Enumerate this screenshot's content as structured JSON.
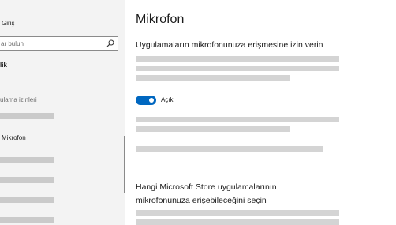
{
  "sidebar": {
    "home_label": "Giriş",
    "search_placeholder": "ar bulun",
    "category_label": "lik",
    "permissions_header": "ulama izinleri",
    "active_item_label": "Mikrofon"
  },
  "main": {
    "title": "Mikrofon",
    "allow_heading": "Uygulamaların mikrofonunuza erişmesine izin verin",
    "toggle_state_label": "Açık",
    "store_heading_line1": "Hangi Microsoft Store uygulamalarının",
    "store_heading_line2": "mikrofonunuza erişebileceğini seçin"
  },
  "colors": {
    "accent": "#0067c0",
    "sidebar_bg": "#f3f3f3",
    "placeholder_bar": "#d4d4d4"
  },
  "icons": {
    "search": "search-icon",
    "toggle": "toggle-switch"
  }
}
